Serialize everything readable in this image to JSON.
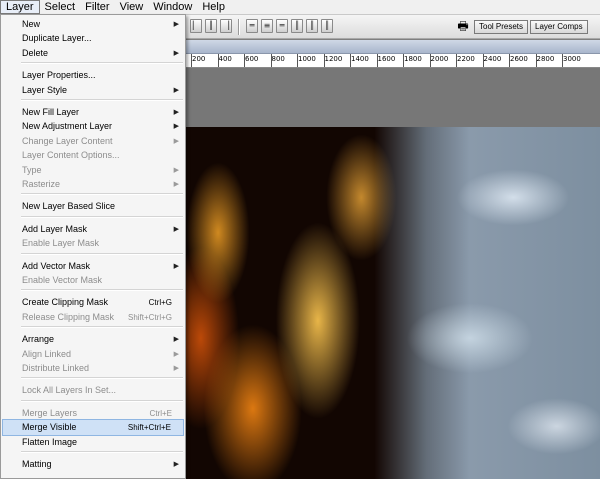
{
  "menubar": {
    "items": [
      "Layer",
      "Select",
      "Filter",
      "View",
      "Window",
      "Help"
    ]
  },
  "well": {
    "tabs": [
      "Tool Presets",
      "Layer Comps"
    ]
  },
  "ruler": {
    "labels": [
      "200",
      "400",
      "600",
      "800",
      "1000",
      "1200",
      "1400",
      "1600",
      "1800",
      "2000",
      "2200",
      "2400",
      "2600",
      "2800",
      "3000"
    ]
  },
  "menu": {
    "items": [
      {
        "label": "New",
        "shortcut": "",
        "submenu": true,
        "disabled": false
      },
      {
        "label": "Duplicate Layer...",
        "shortcut": "",
        "submenu": false,
        "disabled": false
      },
      {
        "label": "Delete",
        "shortcut": "",
        "submenu": true,
        "disabled": false
      },
      {
        "sep": true
      },
      {
        "label": "Layer Properties...",
        "shortcut": "",
        "submenu": false,
        "disabled": false
      },
      {
        "label": "Layer Style",
        "shortcut": "",
        "submenu": true,
        "disabled": false
      },
      {
        "sep": true
      },
      {
        "label": "New Fill Layer",
        "shortcut": "",
        "submenu": true,
        "disabled": false
      },
      {
        "label": "New Adjustment Layer",
        "shortcut": "",
        "submenu": true,
        "disabled": false
      },
      {
        "label": "Change Layer Content",
        "shortcut": "",
        "submenu": true,
        "disabled": true
      },
      {
        "label": "Layer Content Options...",
        "shortcut": "",
        "submenu": false,
        "disabled": true
      },
      {
        "label": "Type",
        "shortcut": "",
        "submenu": true,
        "disabled": true
      },
      {
        "label": "Rasterize",
        "shortcut": "",
        "submenu": true,
        "disabled": true
      },
      {
        "sep": true
      },
      {
        "label": "New Layer Based Slice",
        "shortcut": "",
        "submenu": false,
        "disabled": false
      },
      {
        "sep": true
      },
      {
        "label": "Add Layer Mask",
        "shortcut": "",
        "submenu": true,
        "disabled": false
      },
      {
        "label": "Enable Layer Mask",
        "shortcut": "",
        "submenu": false,
        "disabled": true
      },
      {
        "sep": true
      },
      {
        "label": "Add Vector Mask",
        "shortcut": "",
        "submenu": true,
        "disabled": false
      },
      {
        "label": "Enable Vector Mask",
        "shortcut": "",
        "submenu": false,
        "disabled": true
      },
      {
        "sep": true
      },
      {
        "label": "Create Clipping Mask",
        "shortcut": "Ctrl+G",
        "submenu": false,
        "disabled": false
      },
      {
        "label": "Release Clipping Mask",
        "shortcut": "Shift+Ctrl+G",
        "submenu": false,
        "disabled": true
      },
      {
        "sep": true
      },
      {
        "label": "Arrange",
        "shortcut": "",
        "submenu": true,
        "disabled": false
      },
      {
        "label": "Align Linked",
        "shortcut": "",
        "submenu": true,
        "disabled": true
      },
      {
        "label": "Distribute Linked",
        "shortcut": "",
        "submenu": true,
        "disabled": true
      },
      {
        "sep": true
      },
      {
        "label": "Lock All Layers In Set...",
        "shortcut": "",
        "submenu": false,
        "disabled": true
      },
      {
        "sep": true
      },
      {
        "label": "Merge Layers",
        "shortcut": "Ctrl+E",
        "submenu": false,
        "disabled": true
      },
      {
        "label": "Merge Visible",
        "shortcut": "Shift+Ctrl+E",
        "submenu": false,
        "disabled": false,
        "highlighted": true
      },
      {
        "label": "Flatten Image",
        "shortcut": "",
        "submenu": false,
        "disabled": false
      },
      {
        "sep": true
      },
      {
        "label": "Matting",
        "shortcut": "",
        "submenu": true,
        "disabled": false
      }
    ]
  }
}
